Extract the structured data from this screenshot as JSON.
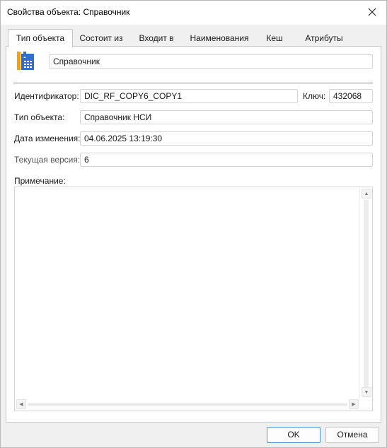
{
  "window": {
    "title": "Свойства объекта: Справочник"
  },
  "tabs": [
    {
      "label": "Тип объекта"
    },
    {
      "label": "Состоит из"
    },
    {
      "label": "Входит в"
    },
    {
      "label": "Наименования"
    },
    {
      "label": "Кеш"
    },
    {
      "label": "Атрибуты"
    }
  ],
  "object": {
    "name": "Справочник",
    "icon": "dictionary-book-icon",
    "icon_colors": {
      "spine": "#f0a020",
      "cover": "#2f6fcf"
    }
  },
  "fields": {
    "identifier_label": "Идентификатор:",
    "identifier_value": "DIC_RF_COPY6_COPY1",
    "key_label": "Ключ:",
    "key_value": "432068",
    "type_label": "Тип объекта:",
    "type_value": "Справочник НСИ",
    "modified_label": "Дата изменения:",
    "modified_value": "04.06.2025 13:19:30",
    "version_label": "Текущая версия:",
    "version_value": "6",
    "notes_label": "Примечание:",
    "notes_value": ""
  },
  "buttons": {
    "ok": "OK",
    "cancel": "Отмена"
  },
  "colors": {
    "primary_button_border": "#4a90d9",
    "window_background": "#f0f0f0"
  }
}
